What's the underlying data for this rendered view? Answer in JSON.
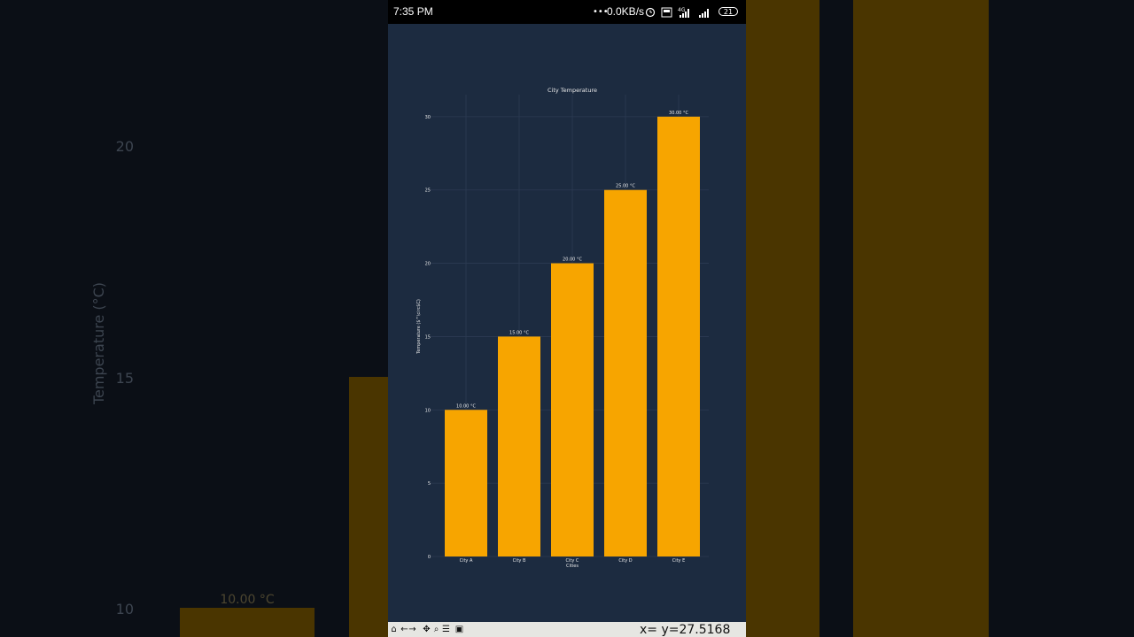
{
  "status_bar": {
    "time": "7:35 PM",
    "network_speed": "0.0KB/s",
    "signal_label": "4G",
    "battery": "21"
  },
  "chart_data": {
    "type": "bar",
    "title": "City Temperature",
    "xlabel": "Cities",
    "ylabel": "Temperature ($^\\circ$C)",
    "categories": [
      "City A",
      "City B",
      "City C",
      "City D",
      "City E"
    ],
    "values": [
      10,
      15,
      20,
      25,
      30
    ],
    "data_labels": [
      "10.00 °C",
      "15.00 °C",
      "20.00 °C",
      "25.00 °C",
      "30.00 °C"
    ],
    "ylim": [
      0,
      31.5
    ],
    "yticks": [
      0,
      5,
      10,
      15,
      20,
      25,
      30
    ],
    "grid": true,
    "colors": {
      "bar": "#f7a500",
      "background": "#1c2b40",
      "text": "#e8e8e8",
      "grid": "#2c3b52"
    }
  },
  "background": {
    "visible_ticks": [
      "20",
      "15",
      "10"
    ],
    "ylabel": "Temperature (°C)",
    "bar_label": "10.00 °C"
  },
  "toolbar": {
    "icons": [
      "home-icon",
      "back-icon",
      "forward-icon",
      "pan-icon",
      "zoom-icon",
      "configure-icon",
      "save-icon"
    ],
    "coords": "x= y=27.5168"
  }
}
